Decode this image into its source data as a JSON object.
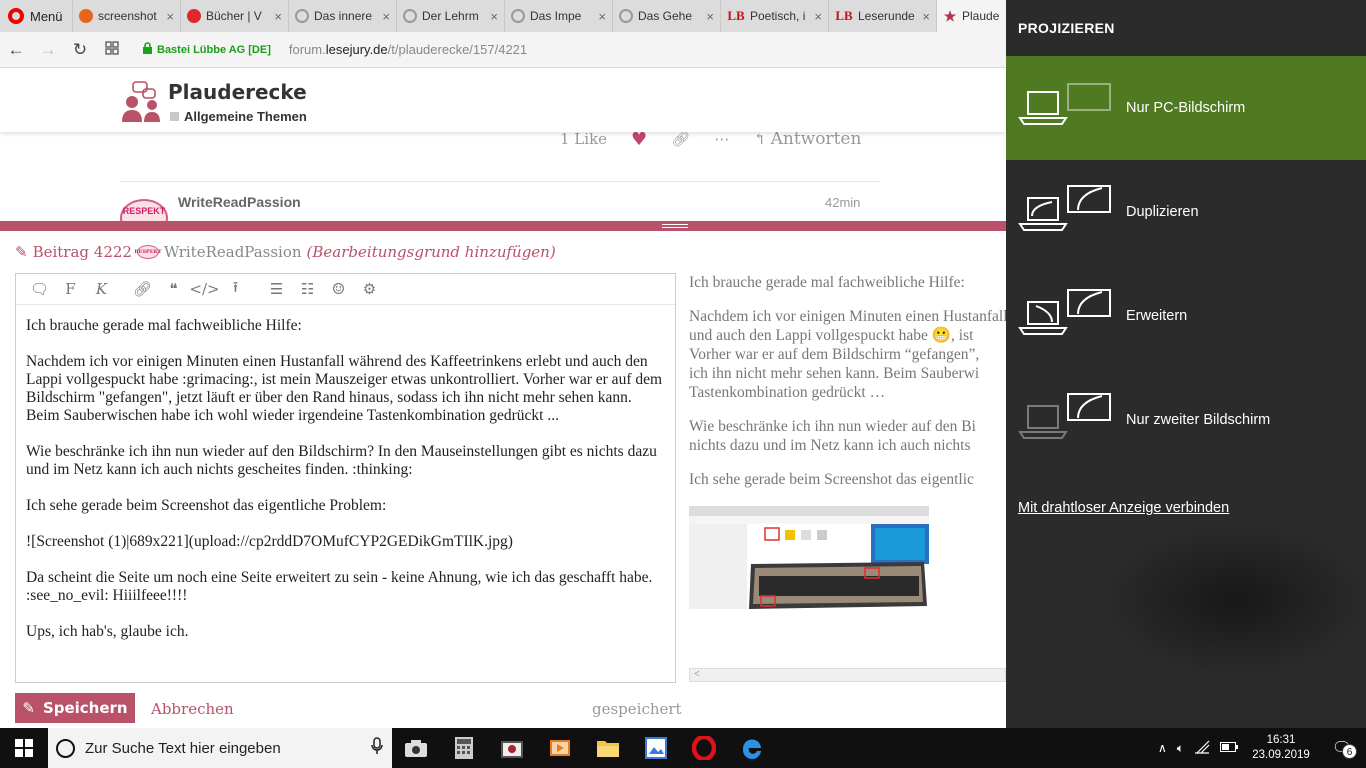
{
  "browser": {
    "menu_label": "Menü",
    "tabs": [
      {
        "label": "screenshot",
        "favicon": "orange"
      },
      {
        "label": "Bücher | V",
        "favicon": "red"
      },
      {
        "label": "Das innere",
        "favicon": "loading"
      },
      {
        "label": "Der Lehrm",
        "favicon": "loading"
      },
      {
        "label": "Das Impe",
        "favicon": "loading"
      },
      {
        "label": "Das Gehe",
        "favicon": "loading"
      },
      {
        "label": "Poetisch, i",
        "favicon": "lb"
      },
      {
        "label": "Leserunde",
        "favicon": "lb"
      },
      {
        "label": "Plaudere",
        "favicon": "star",
        "active": true
      }
    ],
    "fav_lb_text": "LB",
    "close_glyph": "×",
    "site_identity": "Bastei Lübbe AG [DE]",
    "url_prefix": "forum.",
    "url_host": "lesejury.de",
    "url_path": "/t/plauderecke/157/4221"
  },
  "forum": {
    "title": "Plauderecke",
    "category": "Allgemeine Themen",
    "like_count": "1 Like",
    "reply_label": "Antworten",
    "post_author": "WriteReadPassion",
    "post_time": "42min",
    "avatar_badge_text": "RESPEKT"
  },
  "composer": {
    "post_ref": "Beitrag 4222",
    "user": "WriteReadPassion",
    "edit_reason": "(Bearbeitungsgrund hinzufügen)",
    "mini_badge_text": "RESPEKT",
    "toolbar": {
      "bold": "F",
      "italic": "K"
    },
    "paragraphs": [
      "Ich brauche gerade mal fachweibliche Hilfe:",
      "Nachdem ich vor einigen Minuten einen Hustanfall während des Kaffeetrinkens erlebt und auch den Lappi vollgespuckt habe :grimacing:, ist mein Mauszeiger etwas unkontrolliert. Vorher war er auf dem Bildschirm \"gefangen\", jetzt läuft er über den Rand hinaus, sodass ich ihn nicht mehr sehen kann. Beim Sauberwischen habe ich wohl wieder irgendeine Tastenkombination gedrückt ...",
      "Wie beschränke ich ihn nun wieder auf den Bildschirm? In den Mauseinstellungen gibt es nichts dazu und im Netz kann ich auch nichts gescheites finden. :thinking:",
      "Ich sehe gerade beim Screenshot das eigentliche Problem:",
      "![Screenshot (1)|689x221](upload://cp2rddD7OMufCYP2GEDikGmTIlK.jpg)",
      "Da scheint die Seite um noch eine Seite erweitert zu sein - keine Ahnung, wie ich das geschafft habe. :see_no_evil: Hiiilfeee!!!!",
      "Ups, ich hab's, glaube ich."
    ],
    "preview_paragraphs": [
      "Ich brauche gerade mal fachweibliche Hilfe:",
      "Nachdem ich vor einigen Minuten einen Hustanfall\nund auch den Lappi vollgespuckt habe 😬, ist\nVorher war er auf dem Bildschirm “gefangen”,\nich ihn nicht mehr sehen kann. Beim Sauberwi\nTastenkombination gedrückt …",
      "Wie beschränke ich ihn nun wieder auf den Bi\nnichts dazu und im Netz kann ich auch nichts",
      "Ich sehe gerade beim Screenshot das eigentlic"
    ],
    "preview_scroll_glyph": "<",
    "save_label": "Speichern",
    "cancel_label": "Abbrechen",
    "status": "gespeichert"
  },
  "project_panel": {
    "title": "PROJIZIEREN",
    "options": [
      {
        "label": "Nur PC-Bildschirm",
        "selected": true
      },
      {
        "label": "Duplizieren",
        "selected": false
      },
      {
        "label": "Erweitern",
        "selected": false
      },
      {
        "label": "Nur zweiter Bildschirm",
        "selected": false
      }
    ],
    "wireless_link": "Mit drahtloser Anzeige verbinden"
  },
  "taskbar": {
    "search_placeholder": "Zur Suche Text hier eingeben",
    "time": "16:31",
    "date": "23.09.2019",
    "notification_count": "6"
  },
  "colors": {
    "accent": "#b95268",
    "panel_bg": "#2b2b2b",
    "panel_selected": "#4f7a21",
    "taskbar": "#101010"
  }
}
